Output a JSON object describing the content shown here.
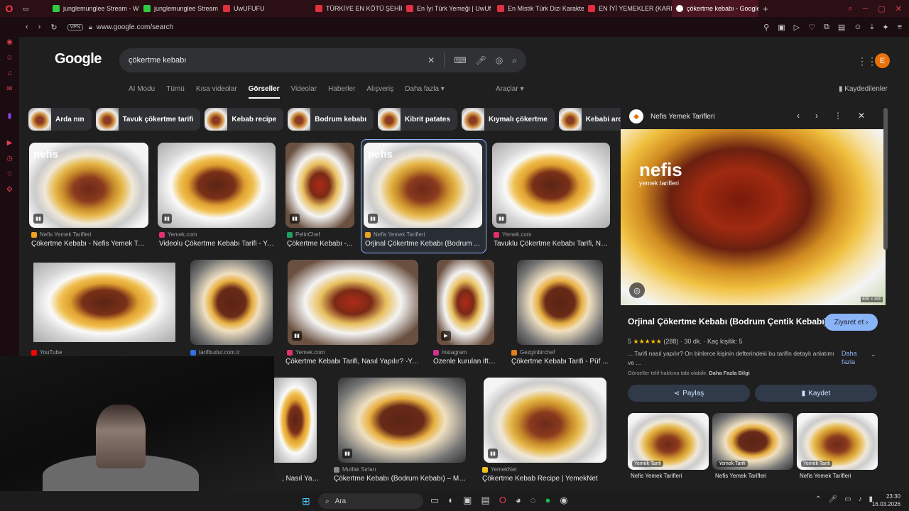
{
  "browser": {
    "tabs": [
      {
        "label": "junglemunglee Stream - W",
        "color": "#2ecc40"
      },
      {
        "label": "junglemunglee Stream",
        "color": "#2ecc40"
      },
      {
        "label": "UwUFUFU",
        "color": "#e03040"
      },
      {
        "label": "TÜRKİYE EN KÖTÜ ŞEHİR",
        "color": "#e03040"
      },
      {
        "label": "En İyi Türk Yemeği | UwUf",
        "color": "#e03040"
      },
      {
        "label": "En Mistik Türk Dizi Karakte",
        "color": "#e03040"
      },
      {
        "label": "EN İYİ YEMEKLER (KARIŞI",
        "color": "#e03040"
      },
      {
        "label": "çökertme kebabı - Google",
        "color": "#ffffff"
      }
    ],
    "new_tab": "+",
    "vpn": "VPN",
    "url": "www.google.com/search"
  },
  "google": {
    "logo": "Google",
    "query": "çökertme kebabı",
    "avatar_letter": "E",
    "nav": [
      "AI Modu",
      "Tümü",
      "Kısa videolar",
      "Görseller",
      "Videolar",
      "Haberler",
      "Alışveriş",
      "Daha fazla ▾"
    ],
    "tools": "Araçlar ▾",
    "saved": "Kaydedilenler",
    "chips": [
      "Arda nın",
      "Tavuk çökertme tarifi",
      "Kebab recipe",
      "Bodrum kebabı",
      "Kibrit patates",
      "Kıymalı çökertme",
      "Kebabi arda"
    ]
  },
  "results": [
    {
      "source": "Nefis Yemek Tarifleri",
      "caption": "Çökertme Kebabı - Nefis Yemek Ta...",
      "favcolor": "#f0a020"
    },
    {
      "source": "Yemek.com",
      "caption": "Videolu Çökertme Kebabı Tarifi - Ye...",
      "favcolor": "#e03070"
    },
    {
      "source": "PelinChef",
      "caption": "Çökertme Kebabı -...",
      "favcolor": "#20a060"
    },
    {
      "source": "Nefis Yemek Tarifleri",
      "caption": "Orjinal Çökertme Kebabı (Bodrum ...",
      "favcolor": "#f0a020"
    },
    {
      "source": "Yemek.com",
      "caption": "Tavuklu Çökertme Kebabı Tarifi, Na...",
      "favcolor": "#e03070"
    },
    {
      "source": "YouTube",
      "caption": "",
      "favcolor": "#ff0000"
    },
    {
      "source": "tarifbudur.com.tr",
      "caption": "",
      "favcolor": "#3070e0"
    },
    {
      "source": "Yemek.com",
      "caption": "Çökertme Kebabı Tarifi, Nasıl Yapılır? -Ye...",
      "favcolor": "#e03070"
    },
    {
      "source": "Instagram",
      "caption": "Özenle kurulan ifta...",
      "favcolor": "#d03090"
    },
    {
      "source": "Gezginbirchef",
      "caption": "Çökertme Kebabı Tarifi - Püf ...",
      "favcolor": "#e08020"
    },
    {
      "source": "",
      "caption": ", Nasıl Yapıl...",
      "favcolor": "#e03070"
    },
    {
      "source": "Mutfak Sırları",
      "caption": "Çökertme Kebabı (Bodrum Kebabı) – Mut...",
      "favcolor": "#8a8a8a"
    },
    {
      "source": "YemekNet",
      "caption": "Çökertme Kebab Recipe | YemekNet",
      "favcolor": "#f0c020"
    }
  ],
  "thumb_watermark": "nefis",
  "panel": {
    "source": "Nefis Yemek Tarifleri",
    "brand": "nefis",
    "brand_sub": "yemek tarifleri",
    "dims": "600 × 400",
    "title": "Orjinal Çökertme Kebabı (Bodrum Çentik Kebabı)",
    "visit": "Ziyaret et",
    "rating_value": "5",
    "stars": "★★★★★",
    "reviews": "(288)",
    "time": "30 dk.",
    "servings": "Kaç kişilik: 5",
    "description": "... Tarifi nasıl yapılır? On binlerce kişinin defterindeki bu tarifin detaylı anlatımı ve ...",
    "more": "Daha fazla",
    "copyright": "Görseller telif hakkına tabi olabilir.",
    "more_info": "Daha Fazla Bilgi",
    "share": "Paylaş",
    "save": "Kaydet",
    "related_badge": "Yemek Tarifi",
    "related_source": "Nefis Yemek Tarifleri"
  },
  "taskbar": {
    "search": "Ara",
    "time": "23:30",
    "date": "16.03.2026"
  }
}
